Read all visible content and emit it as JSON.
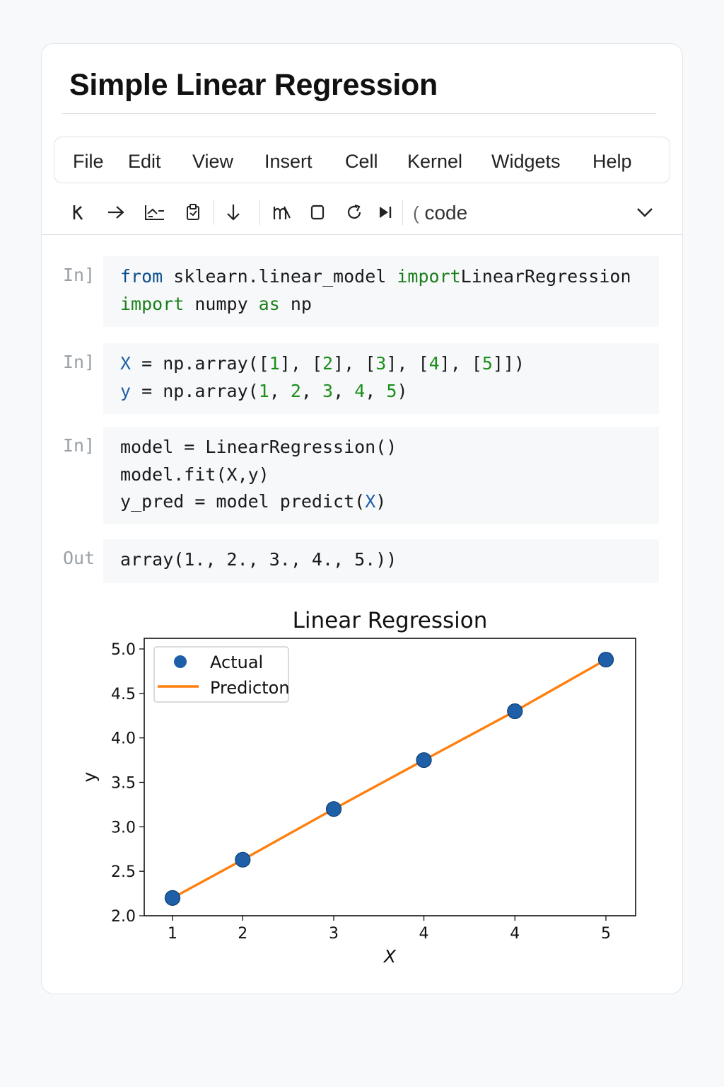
{
  "page": {
    "title": "Simple Linear Regression"
  },
  "menu": [
    "File",
    "Edit",
    "View",
    "Insert",
    "Cell",
    "Kernel",
    "Widgets",
    "Help"
  ],
  "toolbar": {
    "cell_type": "code",
    "icons": [
      "save-icon",
      "arrow-right-icon",
      "cut-icon",
      "paste-icon",
      "move-down-icon",
      "run-icon",
      "stop-icon",
      "restart-icon",
      "run-all-icon",
      "chevron-down-icon"
    ]
  },
  "cells": [
    {
      "prompt": "In]",
      "lines": [
        [
          {
            "t": "from",
            "c": "kw2"
          },
          {
            "t": " sklearn.linear_model ",
            "c": ""
          },
          {
            "t": "import",
            "c": "kw"
          },
          {
            "t": "LinearRegression",
            "c": ""
          }
        ],
        [
          {
            "t": "import",
            "c": "kw"
          },
          {
            "t": " numpy ",
            "c": ""
          },
          {
            "t": "as",
            "c": "kw"
          },
          {
            "t": " np",
            "c": ""
          }
        ]
      ]
    },
    {
      "prompt": "In]",
      "lines": [
        [
          {
            "t": "X",
            "c": "var"
          },
          {
            "t": " = np.array([",
            "c": ""
          },
          {
            "t": "1",
            "c": "num"
          },
          {
            "t": "], [",
            "c": ""
          },
          {
            "t": "2",
            "c": "num"
          },
          {
            "t": "], [",
            "c": ""
          },
          {
            "t": "3",
            "c": "num"
          },
          {
            "t": "], [",
            "c": ""
          },
          {
            "t": "4",
            "c": "num"
          },
          {
            "t": "], [",
            "c": ""
          },
          {
            "t": "5",
            "c": "num"
          },
          {
            "t": "]])",
            "c": ""
          }
        ],
        [
          {
            "t": "y",
            "c": "var"
          },
          {
            "t": " = np.array(",
            "c": ""
          },
          {
            "t": "1",
            "c": "num"
          },
          {
            "t": ", ",
            "c": ""
          },
          {
            "t": "2",
            "c": "num"
          },
          {
            "t": ", ",
            "c": ""
          },
          {
            "t": "3",
            "c": "num"
          },
          {
            "t": ", ",
            "c": ""
          },
          {
            "t": "4",
            "c": "num"
          },
          {
            "t": ", ",
            "c": ""
          },
          {
            "t": "5",
            "c": "num"
          },
          {
            "t": ")",
            "c": ""
          }
        ]
      ]
    },
    {
      "prompt": "In]",
      "lines": [
        [
          {
            "t": "model = LinearRegression()",
            "c": ""
          }
        ],
        [
          {
            "t": "model.fit(X,y)",
            "c": ""
          }
        ],
        [
          {
            "t": "y_pred = model predict(",
            "c": ""
          },
          {
            "t": "X",
            "c": "var"
          },
          {
            "t": ")",
            "c": ""
          }
        ]
      ]
    },
    {
      "prompt": "Out",
      "lines": [
        [
          {
            "t": "array(1., 2., 3., 4., 5.))",
            "c": ""
          }
        ]
      ]
    }
  ],
  "chart_data": {
    "type": "scatter",
    "title": "Linear Regression",
    "xlabel": "X",
    "ylabel": "y",
    "ylim": [
      2.0,
      5.0
    ],
    "y_ticks": [
      "2.0",
      "2.5",
      "3.0",
      "3.5",
      "4.0",
      "4.5",
      "5.0"
    ],
    "x_tick_labels": [
      "1",
      "2",
      "3",
      "4",
      "4",
      "5"
    ],
    "grid": false,
    "legend_position": "top-left",
    "series": [
      {
        "name": "Actual",
        "style": "markers",
        "color": "#1f5fa8",
        "y": [
          2.2,
          2.63,
          3.2,
          3.75,
          4.3,
          4.88
        ]
      },
      {
        "name": "Predicton",
        "style": "line",
        "color": "#ff7f0e",
        "y": [
          2.2,
          2.63,
          3.2,
          3.75,
          4.3,
          4.88
        ]
      }
    ]
  }
}
